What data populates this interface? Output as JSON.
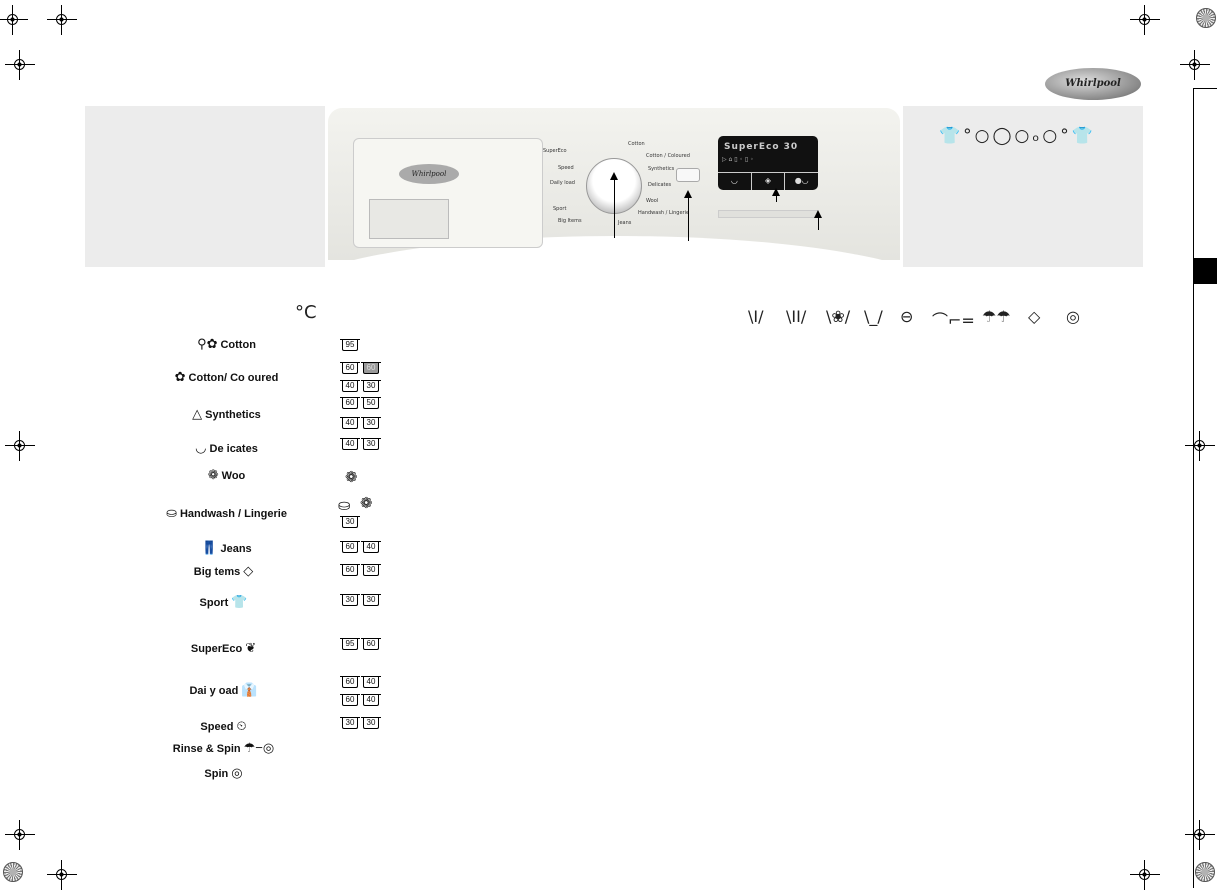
{
  "brand": "Whirlpool",
  "control_panel": {
    "dial_labels": [
      "Cotton",
      "Cotton / Coloured",
      "Synthetics",
      "Delicates",
      "Wool",
      "Handwash / Lingerie",
      "Jeans",
      "Big Items",
      "Sport",
      "SuperEco",
      "Daily load",
      "Speed",
      "Rinse & Spin",
      "Spin"
    ],
    "display_text": "SuperEco 30",
    "display_icons": [
      "prewash-icon",
      "rinse-hold-icon",
      "stain-icon"
    ]
  },
  "cycle_symbols": [
    "prewash-icon",
    "main-wash-icon",
    "softener-icon",
    "wash-icon",
    "energy-icon",
    "drain-icon",
    "rinse-icon",
    "time-icon",
    "spin-icon"
  ],
  "temperature_unit": "°C",
  "programs": [
    {
      "name": "Cotton",
      "icon": "cotton-icon",
      "temps": [
        [
          "95"
        ]
      ]
    },
    {
      "name": "Cotton/ Co oured",
      "icon": "coloured-icon",
      "temps": [
        [
          "60",
          "60"
        ],
        [
          "40",
          "30"
        ]
      ]
    },
    {
      "name": "Synthetics",
      "icon": "synthetics-icon",
      "temps": [
        [
          "60",
          "50"
        ],
        [
          "40",
          "30"
        ]
      ]
    },
    {
      "name": "De icates",
      "icon": "delicates-icon",
      "temps": [
        [
          "40",
          "30"
        ]
      ]
    },
    {
      "name": "Woo",
      "icon": "wool-icon",
      "temps": []
    },
    {
      "name": "Handwash / Lingerie",
      "icon": "handwash-icon",
      "temps": [
        [
          "30"
        ]
      ]
    },
    {
      "name": "Jeans",
      "icon": "jeans-icon",
      "temps": [
        [
          "60",
          "40"
        ]
      ]
    },
    {
      "name": "Big tems",
      "icon": "big-items-icon",
      "temps": [
        [
          "60",
          "30"
        ]
      ]
    },
    {
      "name": "Sport",
      "icon": "sport-icon",
      "temps": [
        [
          "30",
          "30"
        ]
      ]
    },
    {
      "name": "SuperEco",
      "icon": "supereco-icon",
      "temps": [
        [
          "95",
          "60"
        ]
      ]
    },
    {
      "name": "Dai y oad",
      "icon": "daily-load-icon",
      "temps": [
        [
          "60",
          "40"
        ],
        [
          "60",
          "40"
        ]
      ]
    },
    {
      "name": "Speed",
      "icon": "speed-icon",
      "temps": [
        [
          "30",
          "30"
        ]
      ]
    },
    {
      "name": "Rinse & Spin",
      "icon": "rinse-spin-icon",
      "temps": []
    },
    {
      "name": "Spin",
      "icon": "spin-icon",
      "temps": []
    }
  ]
}
